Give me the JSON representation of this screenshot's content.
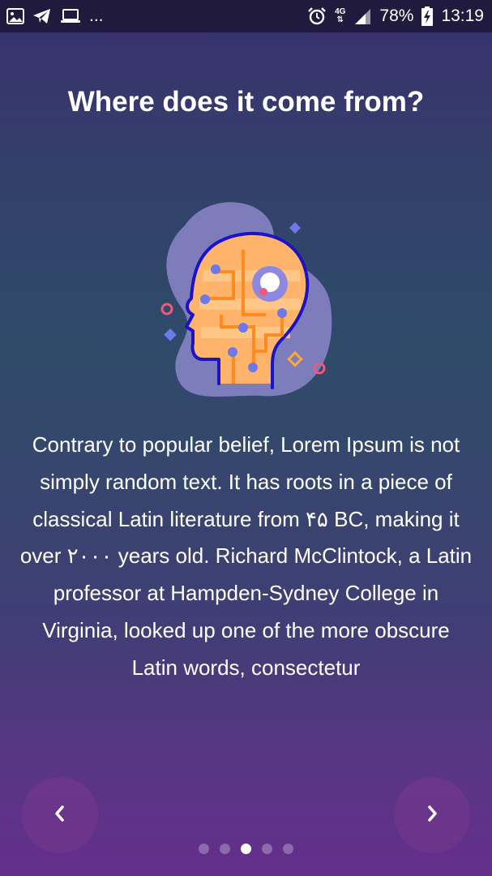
{
  "status_bar": {
    "left_icons": [
      "image-icon",
      "telegram-icon",
      "laptop-icon"
    ],
    "more_indicator": "...",
    "alarm_icon": "alarm-icon",
    "network_type": "4G",
    "signal_icon": "signal-icon",
    "battery_percent": "78%",
    "battery_icon": "battery-charging-icon",
    "time": "13:19"
  },
  "onboarding": {
    "title": "Where does it come from?",
    "illustration": "brain-circuit-head-icon",
    "body": "Contrary to popular belief, Lorem Ipsum is not simply random text. It has roots in a piece of classical Latin literature from ۴۵ BC, making it over ۲۰۰۰ years old. Richard McClintock, a Latin professor at Hampden-Sydney College in Virginia, looked up one of the more obscure Latin words, consectetur"
  },
  "navigation": {
    "prev_icon": "chevron-left-icon",
    "next_icon": "chevron-right-icon",
    "page_count": 5,
    "active_page": 3
  },
  "colors": {
    "status_bar_bg": "#1f1a3e",
    "nav_button_bg": "#70378c",
    "dot_active": "#ffffff",
    "illustration_orange": "#ff9a3c",
    "illustration_outline": "#1a14c8"
  }
}
